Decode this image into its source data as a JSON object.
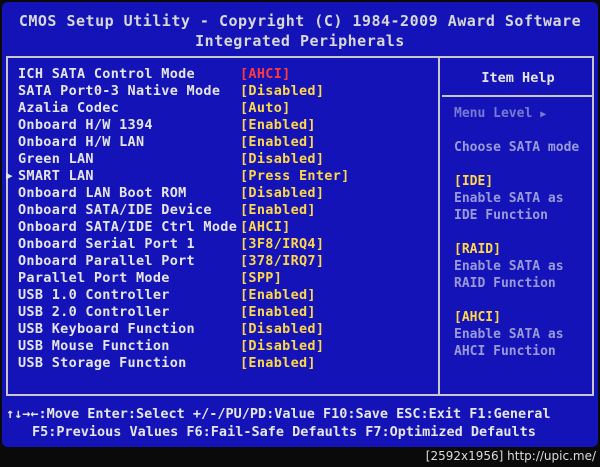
{
  "header": {
    "line1": "CMOS Setup Utility - Copyright (C) 1984-2009 Award Software",
    "line2": "Integrated Peripherals"
  },
  "items": [
    {
      "label": "ICH SATA Control Mode",
      "value": "[AHCI]",
      "selected": true
    },
    {
      "label": "SATA Port0-3 Native Mode",
      "value": "[Disabled]"
    },
    {
      "label": "Azalia Codec",
      "value": "[Auto]"
    },
    {
      "label": "Onboard H/W 1394",
      "value": "[Enabled]"
    },
    {
      "label": "Onboard H/W LAN",
      "value": "[Enabled]"
    },
    {
      "label": "Green LAN",
      "value": "[Disabled]"
    },
    {
      "label": "SMART LAN",
      "value": "[Press Enter]",
      "submenu": true
    },
    {
      "label": "Onboard LAN Boot ROM",
      "value": "[Disabled]"
    },
    {
      "label": "Onboard SATA/IDE Device",
      "value": "[Enabled]"
    },
    {
      "label": "Onboard SATA/IDE Ctrl Mode",
      "value": "[AHCI]"
    },
    {
      "label": "Onboard Serial Port 1",
      "value": "[3F8/IRQ4]"
    },
    {
      "label": "Onboard Parallel Port",
      "value": "[378/IRQ7]"
    },
    {
      "label": "Parallel Port Mode",
      "value": "[SPP]"
    },
    {
      "label": "USB 1.0 Controller",
      "value": "[Enabled]"
    },
    {
      "label": "USB 2.0 Controller",
      "value": "[Enabled]"
    },
    {
      "label": "USB Keyboard Function",
      "value": "[Disabled]"
    },
    {
      "label": "USB Mouse Function",
      "value": "[Disabled]"
    },
    {
      "label": "USB Storage Function",
      "value": "[Enabled]"
    }
  ],
  "help": {
    "title": "Item Help",
    "menu_level": "Menu Level",
    "choose": "Choose SATA mode",
    "ide_head": "[IDE]",
    "ide_l1": "Enable SATA as",
    "ide_l2": "IDE Function",
    "raid_head": "[RAID]",
    "raid_l1": "Enable SATA as",
    "raid_l2": "RAID Function",
    "ahci_head": "[AHCI]",
    "ahci_l1": "Enable SATA as",
    "ahci_l2": "AHCI Function"
  },
  "footer": {
    "line1": "↑↓→←:Move  Enter:Select  +/-/PU/PD:Value  F10:Save  ESC:Exit  F1:General",
    "line2": "F5:Previous Values  F6:Fail-Safe Defaults  F7:Optimized Defaults"
  },
  "watermark": "[2592x1956] http://upic.me/",
  "colors": {
    "background": "#1313b8",
    "label": "#e6e6e6",
    "value": "#ffd84a",
    "selected_value": "#ff3a3a",
    "border": "#c8c8c8"
  }
}
